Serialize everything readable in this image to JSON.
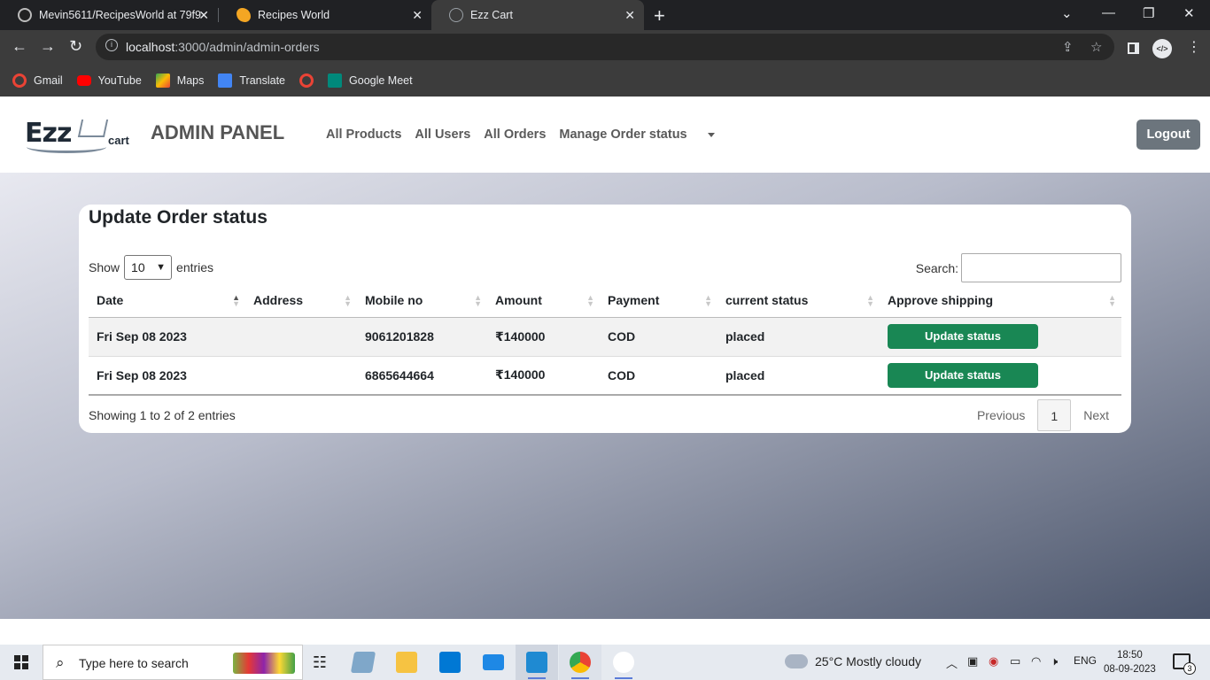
{
  "browser": {
    "tabs": [
      {
        "title": "Mevin5611/RecipesWorld at 79f9",
        "icon": "github-icon"
      },
      {
        "title": "Recipes World",
        "icon": "croissant-icon"
      },
      {
        "title": "Ezz Cart",
        "icon": "globe-icon",
        "active": true
      }
    ],
    "url_host": "localhost",
    "url_path": ":3000/admin/admin-orders",
    "bookmarks": [
      {
        "label": "Gmail",
        "icon": "google-icon",
        "color": "#ea4335"
      },
      {
        "label": "YouTube",
        "icon": "youtube-icon",
        "color": "#ff0000"
      },
      {
        "label": "Maps",
        "icon": "maps-icon",
        "color": "#34a853"
      },
      {
        "label": "Translate",
        "icon": "translate-icon",
        "color": "#4285f4"
      },
      {
        "label": "",
        "icon": "google-icon",
        "color": "#ea4335"
      },
      {
        "label": "Google Meet",
        "icon": "meet-icon",
        "color": "#00897b"
      }
    ]
  },
  "navbar": {
    "logo_main": "Ezz",
    "logo_sub": "cart",
    "brand": "ADMIN PANEL",
    "links": [
      "All Products",
      "All Users",
      "All Orders",
      "Manage Order status"
    ],
    "logout_label": "Logout"
  },
  "orders": {
    "title": "Update Order status",
    "show_label": "Show",
    "entries_label": "entries",
    "page_length": "10",
    "search_label": "Search:",
    "columns": [
      "Date",
      "Address",
      "Mobile no",
      "Amount",
      "Payment",
      "current status",
      "Approve shipping"
    ],
    "rows": [
      {
        "date": "Fri Sep 08 2023",
        "address": "",
        "mobile": "9061201828",
        "amount": "₹140000",
        "payment": "COD",
        "status": "placed",
        "action": "Update status"
      },
      {
        "date": "Fri Sep 08 2023",
        "address": "",
        "mobile": "6865644664",
        "amount": "₹140000",
        "payment": "COD",
        "status": "placed",
        "action": "Update status"
      }
    ],
    "info": "Showing 1 to 2 of 2 entries",
    "pagination": {
      "previous": "Previous",
      "current": "1",
      "next": "Next"
    }
  },
  "taskbar": {
    "search_placeholder": "Type here to search",
    "weather": "25°C  Mostly cloudy",
    "lang": "ENG",
    "time": "18:50",
    "date": "08-09-2023",
    "notifications": "3"
  }
}
